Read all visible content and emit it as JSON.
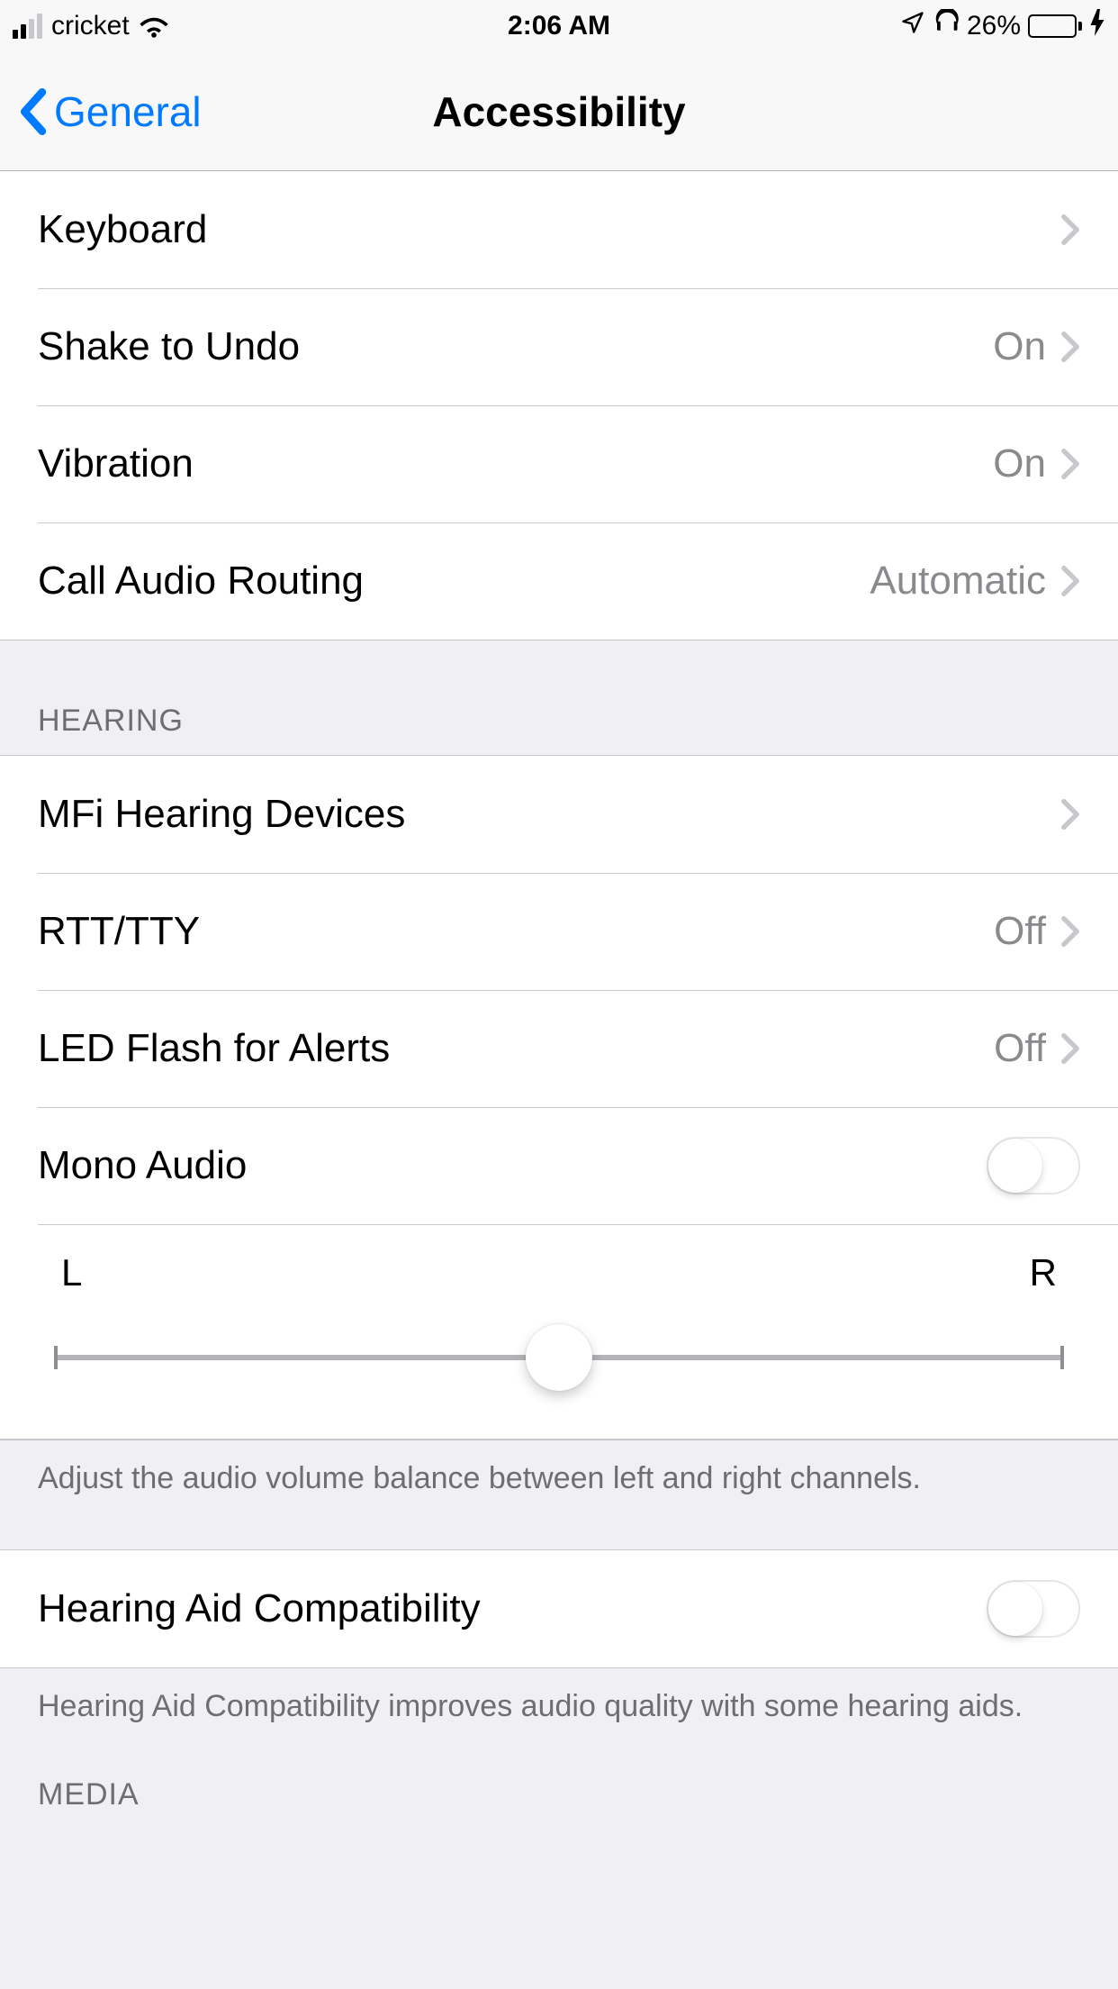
{
  "status_bar": {
    "carrier": "cricket",
    "time": "2:06 AM",
    "battery_pct": "26%"
  },
  "nav": {
    "back_label": "General",
    "title": "Accessibility"
  },
  "interaction": {
    "keyboard": "Keyboard",
    "shake_to_undo": {
      "label": "Shake to Undo",
      "value": "On"
    },
    "vibration": {
      "label": "Vibration",
      "value": "On"
    },
    "call_audio_routing": {
      "label": "Call Audio Routing",
      "value": "Automatic"
    }
  },
  "hearing": {
    "header": "HEARING",
    "mfi": "MFi Hearing Devices",
    "rtt_tty": {
      "label": "RTT/TTY",
      "value": "Off"
    },
    "led_flash": {
      "label": "LED Flash for Alerts",
      "value": "Off"
    },
    "mono_audio": "Mono Audio",
    "balance_left": "L",
    "balance_right": "R",
    "balance_footer": "Adjust the audio volume balance between left and right channels."
  },
  "hac": {
    "label": "Hearing Aid Compatibility",
    "footer": "Hearing Aid Compatibility improves audio quality with some hearing aids."
  },
  "media": {
    "header": "MEDIA"
  }
}
